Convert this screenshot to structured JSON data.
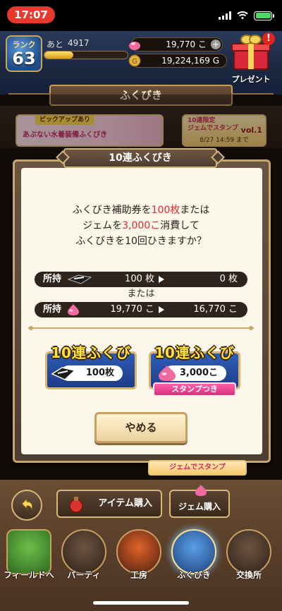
{
  "status_bar": {
    "time": "17:07"
  },
  "header": {
    "rank_label": "ランク",
    "rank_value": "63",
    "exp_prefix": "あと",
    "exp_remaining": "4917",
    "exp_progress": 0.35,
    "gems": "19,770 こ",
    "gold": "19,224,169 G",
    "present_label": "プレゼント",
    "present_badge": "!"
  },
  "title": "ふくびき",
  "banners": {
    "pickup_tag": "ピックアップあり",
    "pickup_title": "あぶない水着装備ふくびき",
    "limited_title_1": "10連限定",
    "limited_title_2": "ジェムでスタンプ",
    "limited_vol": "vol.1",
    "limited_date": "8/27 14:59 まで"
  },
  "modal": {
    "title": "10連ふくびき",
    "msg_line1_pre": "ふくびき補助券を",
    "msg_line1_red": "100枚",
    "msg_line1_post": "または",
    "msg_line2_pre": "ジェムを",
    "msg_line2_red": "3,000こ",
    "msg_line2_post": "消費して",
    "msg_line3": "ふくびきを10回ひきますか？",
    "ticket_row": {
      "label": "所持",
      "from": "100 枚",
      "to": "0 枚"
    },
    "or_text": "または",
    "gem_row": {
      "label": "所持",
      "from": "19,770 こ",
      "to": "16,770 こ"
    },
    "ticket_button": {
      "title": "10連ふくびき",
      "cost": "100枚"
    },
    "gem_button": {
      "title": "10連ふくびき",
      "cost": "3,000こ",
      "stamp": "スタンプつき"
    },
    "cancel": "やめる"
  },
  "stamp_footer": "ジェムでスタンプ",
  "bottom": {
    "item_button": "アイテム購入",
    "gem_button": "ジェム購入",
    "nav": [
      {
        "label": "フィールドへ"
      },
      {
        "label": "パーティ"
      },
      {
        "label": "工房"
      },
      {
        "label": "ふくびき"
      },
      {
        "label": "交換所"
      }
    ]
  },
  "colors": {
    "accent_red": "#e0282e",
    "gold_text": "#ffe23c",
    "frame_gold": "#c6a56e",
    "modal_bg": "#fbf6ea"
  }
}
